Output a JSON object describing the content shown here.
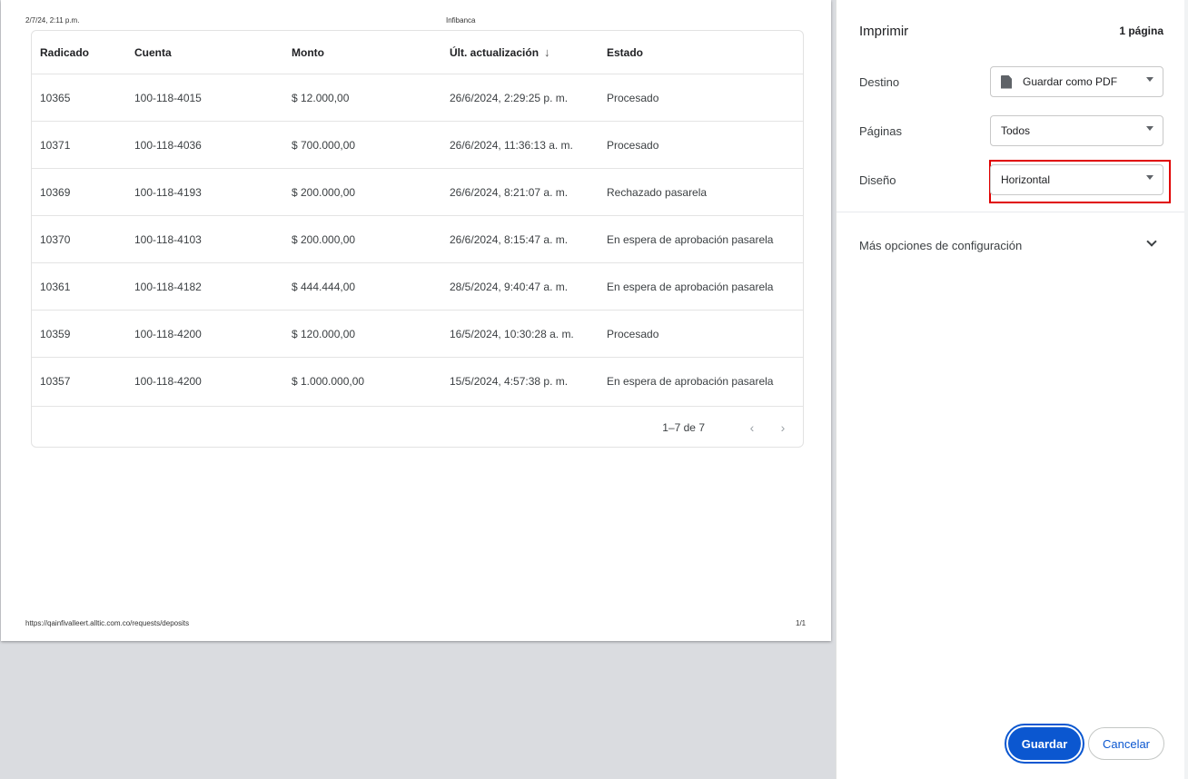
{
  "preview": {
    "header_date": "2/7/24, 2:11 p.m.",
    "header_title": "Infibanca",
    "footer_url": "https://qainfivalleert.alltic.com.co/requests/deposits",
    "footer_page": "1/1",
    "table": {
      "columns": [
        "Radicado",
        "Cuenta",
        "Monto",
        "Últ. actualización",
        "Estado"
      ],
      "sort_icon": "arrow-down-icon",
      "rows": [
        [
          "10365",
          "100-118-4015",
          "$ 12.000,00",
          "26/6/2024, 2:29:25 p. m.",
          "Procesado"
        ],
        [
          "10371",
          "100-118-4036",
          "$ 700.000,00",
          "26/6/2024, 11:36:13 a. m.",
          "Procesado"
        ],
        [
          "10369",
          "100-118-4193",
          "$ 200.000,00",
          "26/6/2024, 8:21:07 a. m.",
          "Rechazado pasarela"
        ],
        [
          "10370",
          "100-118-4103",
          "$ 200.000,00",
          "26/6/2024, 8:15:47 a. m.",
          "En espera de aprobación pasarela"
        ],
        [
          "10361",
          "100-118-4182",
          "$ 444.444,00",
          "28/5/2024, 9:40:47 a. m.",
          "En espera de aprobación pasarela"
        ],
        [
          "10359",
          "100-118-4200",
          "$ 120.000,00",
          "16/5/2024, 10:30:28 a. m.",
          "Procesado"
        ],
        [
          "10357",
          "100-118-4200",
          "$ 1.000.000,00",
          "15/5/2024, 4:57:38 p. m.",
          "En espera de aprobación pasarela"
        ]
      ],
      "pagination": {
        "range": "1–7 de 7",
        "prev": "‹",
        "next": "›"
      }
    }
  },
  "panel": {
    "title": "Imprimir",
    "page_count": "1 página",
    "destination": {
      "label": "Destino",
      "value": "Guardar como PDF"
    },
    "pages": {
      "label": "Páginas",
      "value": "Todos"
    },
    "layout": {
      "label": "Diseño",
      "value": "Horizontal"
    },
    "more_options": "Más opciones de configuración",
    "save_label": "Guardar",
    "cancel_label": "Cancelar",
    "accent": "#0b57d0",
    "highlight_color": "#e00000"
  }
}
